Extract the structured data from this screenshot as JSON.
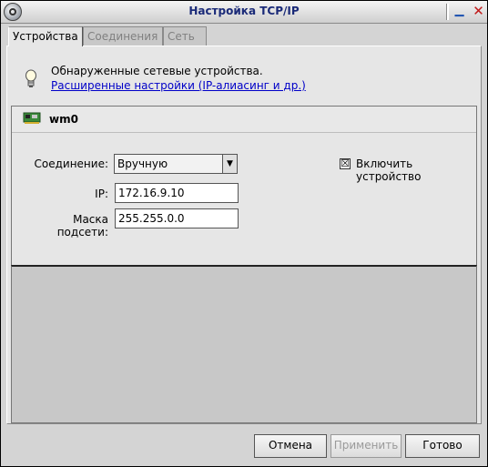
{
  "window": {
    "title": "Настройка TCP/IP"
  },
  "tabs": [
    {
      "label": "Устройства",
      "active": true
    },
    {
      "label": "Соединения",
      "active": false
    },
    {
      "label": "Сеть",
      "active": false
    }
  ],
  "info": {
    "text": "Обнаруженные сетевые устройства.",
    "link": "Расширенные настройки (IP-алиасинг и др.)"
  },
  "device": {
    "name": "wm0",
    "connection_label": "Соединение:",
    "connection_value": "Вручную",
    "ip_label": "IP:",
    "ip_value": "172.16.9.10",
    "mask_label": "Маска подсети:",
    "mask_value": "255.255.0.0",
    "enable_label": "Включить устройство",
    "enable_checked": "☒"
  },
  "buttons": {
    "cancel": "Отмена",
    "apply": "Применить",
    "done": "Готово"
  },
  "colors": {
    "title_text": "#1a2a78",
    "link": "#0000c8",
    "close": "#c01a1a"
  },
  "icons": {
    "app": "app-gear-icon",
    "bulb": "lightbulb-icon",
    "nic": "network-card-icon"
  }
}
